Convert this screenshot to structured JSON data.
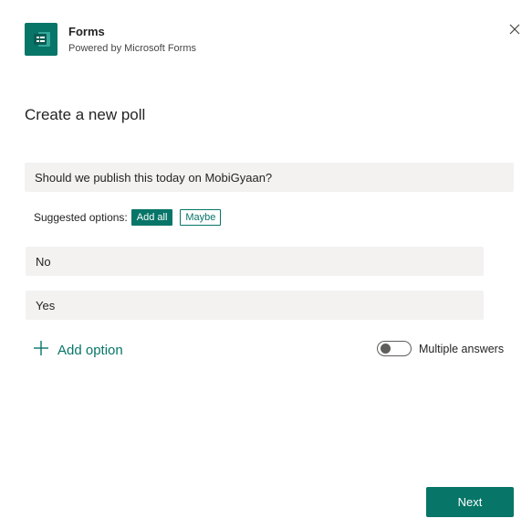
{
  "header": {
    "app_name": "Forms",
    "app_subtitle": "Powered by Microsoft Forms",
    "icon": "forms-logo-icon",
    "close_icon": "close-icon"
  },
  "page_title": "Create a new poll",
  "question": {
    "value": "Should we publish this today on MobiGyaan?"
  },
  "suggested": {
    "label": "Suggested options:",
    "add_all": "Add all",
    "maybe": "Maybe"
  },
  "options": [
    "No",
    "Yes"
  ],
  "add_option": {
    "label": "Add option",
    "icon": "plus-icon"
  },
  "multiple_answers": {
    "label": "Multiple answers",
    "enabled": false
  },
  "footer": {
    "next_label": "Next"
  },
  "colors": {
    "accent": "#077568",
    "field_bg": "#f3f2f1"
  }
}
